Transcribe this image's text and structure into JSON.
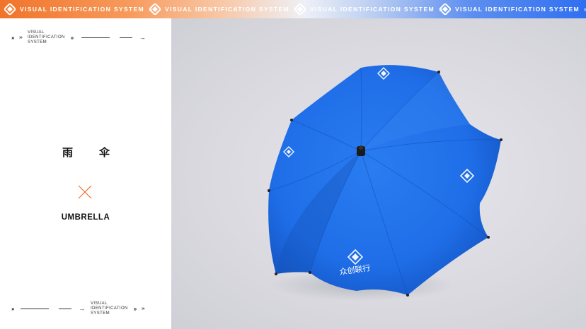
{
  "banner": {
    "items": [
      {
        "text": "VISUAL IDENTIFICATION SYSTEM",
        "arrow": "»"
      },
      {
        "text": "VISUAL IDENTIFICATION SYSTEM",
        "arrow": "»"
      },
      {
        "text": "VISUAL IDENTIFICATION SYSTEM",
        "arrow": "»"
      },
      {
        "text": "VISUAL IDENTIFICATION SYSTEM",
        "arrow": "»"
      }
    ]
  },
  "left_panel": {
    "top_nav": {
      "double_arrow": "»",
      "triple_arrow": "›››",
      "label_line1": "VISUAL",
      "label_line2": "IDENTIFICATION",
      "label_line3": "SYSTEM",
      "arrow_after_label": "»",
      "end_arrow": "→"
    },
    "title_cn_char1": "雨",
    "title_cn_char2": "伞",
    "title_en": "UMBRELLA",
    "bottom_nav": {
      "double_arrow": "»",
      "end_arrow": "→",
      "label_line1": "VISUAL",
      "label_line2": "IDENTIFICATION",
      "label_line3": "SYSTEM",
      "arrow_after_label": "»",
      "triple_arrow": "›››"
    }
  },
  "photo": {
    "umbrella_brand_text": "众创联行",
    "canopy_color": "#1f6ee8"
  },
  "colors": {
    "accent_orange": "#f0742a",
    "accent_blue": "#2f6ff0"
  }
}
